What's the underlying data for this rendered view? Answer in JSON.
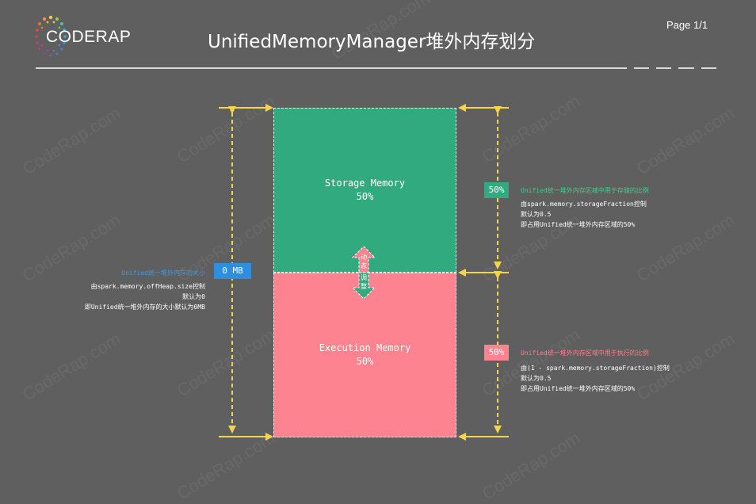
{
  "header": {
    "logo_text": "CODERAP",
    "title": "UnifiedMemoryManager堆外内存划分",
    "page": "Page 1/1"
  },
  "diagram": {
    "storage": {
      "name": "Storage Memory",
      "percent": "50%"
    },
    "execution": {
      "name": "Execution Memory",
      "percent": "50%"
    },
    "dynamic_label": [
      "动",
      "态",
      "调",
      "整"
    ],
    "total_tag": "0 MB",
    "total_note": {
      "heading": "Unified统一堆外内存的大小",
      "lines": [
        "由spark.memory.offHeap.size控制",
        "默认为0",
        "即Unified统一堆外内存的大小默认为0MB"
      ]
    },
    "storage_tag": "50%",
    "storage_note": {
      "heading": "Unified统一堆外内存区域中用于存储的比例",
      "lines": [
        "由spark.memory.storageFraction控制",
        "默认为0.5",
        "即占用Unified统一堆外内存区域的50%"
      ]
    },
    "execution_tag": "50%",
    "execution_note": {
      "heading": "Unified统一堆外内存区域中用于执行的比例",
      "lines": [
        "由(1 - spark.memory.storageFraction)控制",
        "默认为0.5",
        "即占用Unified统一堆外内存区域的50%"
      ]
    },
    "watermark": "CodeRap.com"
  },
  "colors": {
    "background": "#5f5f5f",
    "storage": "#31aa80",
    "execution": "#fc838f",
    "total_tag": "#2e8fe0",
    "total_heading": "#3d9be8",
    "storage_heading": "#3fcf8c",
    "execution_heading": "#ff7d8a",
    "arrow": "#f5d548"
  }
}
